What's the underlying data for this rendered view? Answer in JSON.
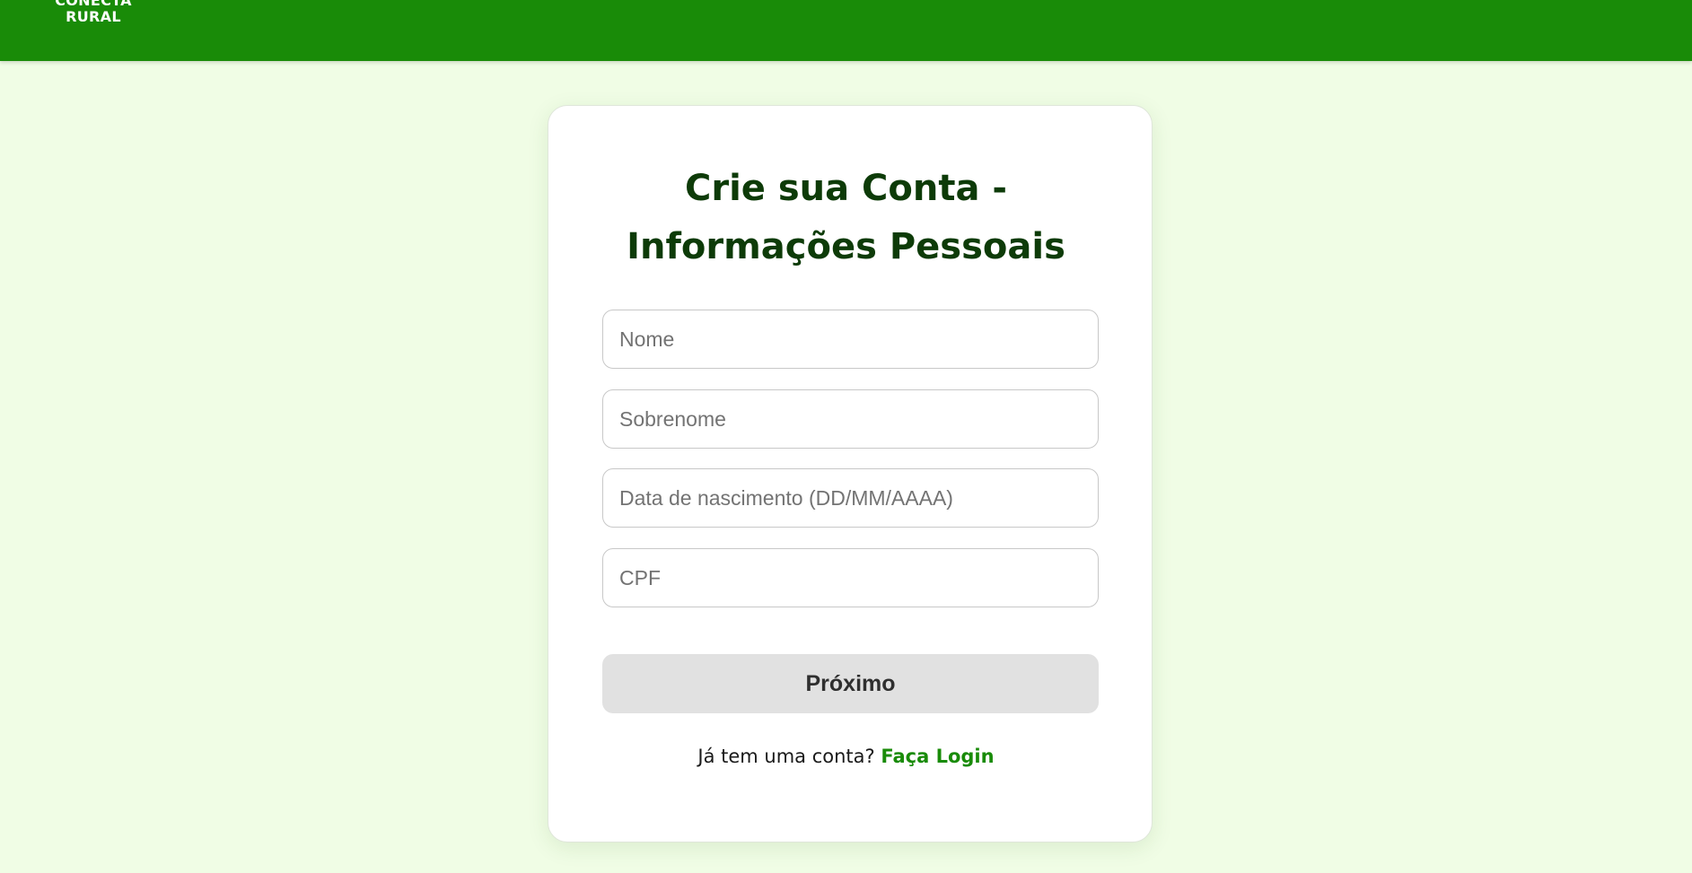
{
  "header": {
    "brand_line1": "CONECTA",
    "brand_line2": "RURAL",
    "background_color": "#198b08"
  },
  "form": {
    "title_line1": "Crie sua Conta -",
    "title_line2": "Informações Pessoais",
    "fields": {
      "nome": {
        "placeholder": "Nome",
        "value": ""
      },
      "sobrenome": {
        "placeholder": "Sobrenome",
        "value": ""
      },
      "data_nascimento": {
        "placeholder": "Data de nascimento (DD/MM/AAAA)",
        "value": ""
      },
      "cpf": {
        "placeholder": "CPF",
        "value": ""
      }
    },
    "next_button_label": "Próximo",
    "login_prompt": "Já tem uma conta?",
    "login_link_label": "Faça Login"
  },
  "colors": {
    "page_background": "#f0fde5",
    "accent_green": "#198b08",
    "title_color": "#0d3b08",
    "button_background": "#e1e1e1"
  }
}
